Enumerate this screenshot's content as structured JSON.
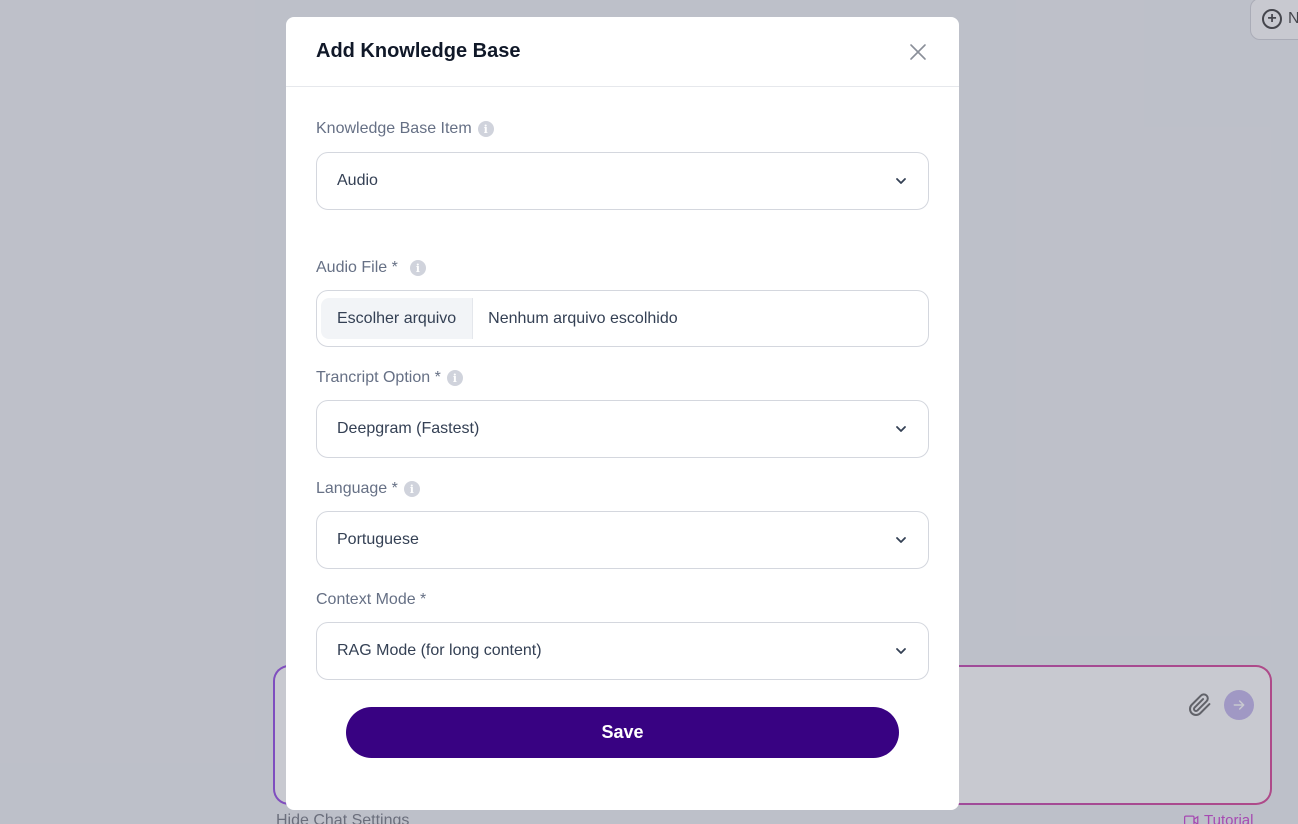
{
  "background": {
    "new_chat_label": "N",
    "hide_settings_label": "Hide Chat Settings",
    "tutorial_label": "Tutorial"
  },
  "modal": {
    "title": "Add Knowledge Base",
    "fields": {
      "kb_item": {
        "label": "Knowledge Base Item",
        "value": "Audio"
      },
      "audio_file": {
        "label": "Audio File *",
        "button": "Escolher arquivo",
        "status": "Nenhum arquivo escolhido"
      },
      "transcript": {
        "label": "Trancript Option *",
        "value": "Deepgram (Fastest)"
      },
      "language": {
        "label": "Language *",
        "value": "Portuguese"
      },
      "context_mode": {
        "label": "Context Mode *",
        "value": "RAG Mode (for long content)"
      }
    },
    "save_label": "Save"
  },
  "colors": {
    "primary": "#380282",
    "overlay": "#858896",
    "gradient_start": "#7b1fe0",
    "gradient_end": "#d0187e"
  }
}
